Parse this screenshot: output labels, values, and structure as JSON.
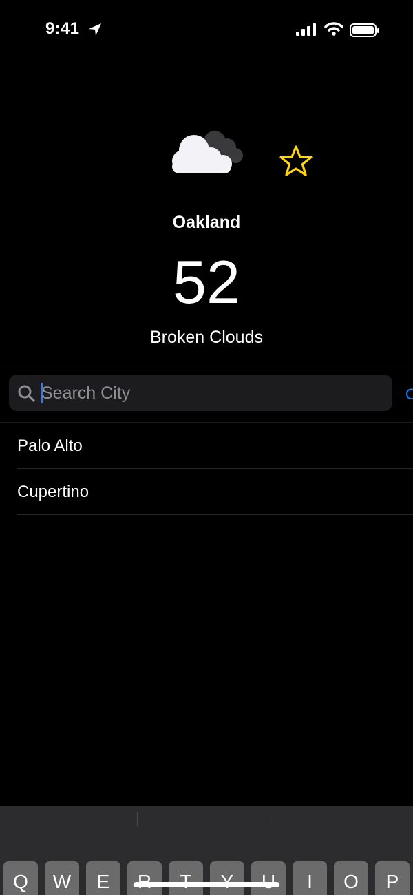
{
  "status_bar": {
    "time": "9:41"
  },
  "weather": {
    "city": "Oakland",
    "temperature": "52",
    "condition": "Broken Clouds",
    "icon": "cloud-icon",
    "favorite_icon": "star-outline-icon",
    "favorite_color": "#ffd60a"
  },
  "search": {
    "placeholder": "Search City",
    "value": "",
    "cancel_label": "C",
    "accent_color": "#0a84ff"
  },
  "cities": [
    {
      "label": "Palo Alto"
    },
    {
      "label": "Cupertino"
    }
  ],
  "keyboard": {
    "top_row": [
      "Q",
      "W",
      "E",
      "R",
      "T",
      "Y",
      "U",
      "I",
      "O",
      "P"
    ]
  }
}
